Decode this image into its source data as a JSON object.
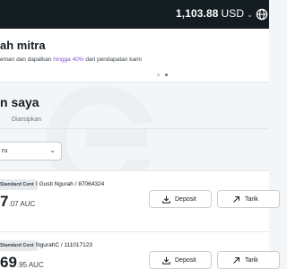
{
  "header": {
    "balance_amount": "1,103.88",
    "balance_currency": "USD",
    "balance_chevron": "⌄",
    "globe_icon": "globe-icon"
  },
  "promo": {
    "title": "ah mitra",
    "subtitle_before": "eman dan dapatkan ",
    "subtitle_highlight": "hingga 40%",
    "subtitle_after": " dari pendapatan kami",
    "highlight_color": "#7f56c9"
  },
  "accounts": {
    "title": "n saya",
    "tab_archived": "Diarsipkan",
    "filter_label": "ru",
    "filter_chevron": "⌄",
    "items": [
      {
        "badge": "Standard Cent",
        "name": "I Gusti Ngurah / 87064324",
        "amount_main": "7",
        "amount_fraction": ".07 AUC",
        "deposit_label": "Deposit",
        "withdraw_label": "Tarik"
      },
      {
        "badge": "Standard Cent",
        "name": "NgurahC / 111017123",
        "amount_main": "69",
        "amount_fraction": ".95 AUC",
        "deposit_label": "Deposit",
        "withdraw_label": "Tarik"
      }
    ]
  },
  "colors": {
    "topbar": "#141d22",
    "accent_purple": "#7f56c9",
    "background": "#f3f5f7"
  }
}
